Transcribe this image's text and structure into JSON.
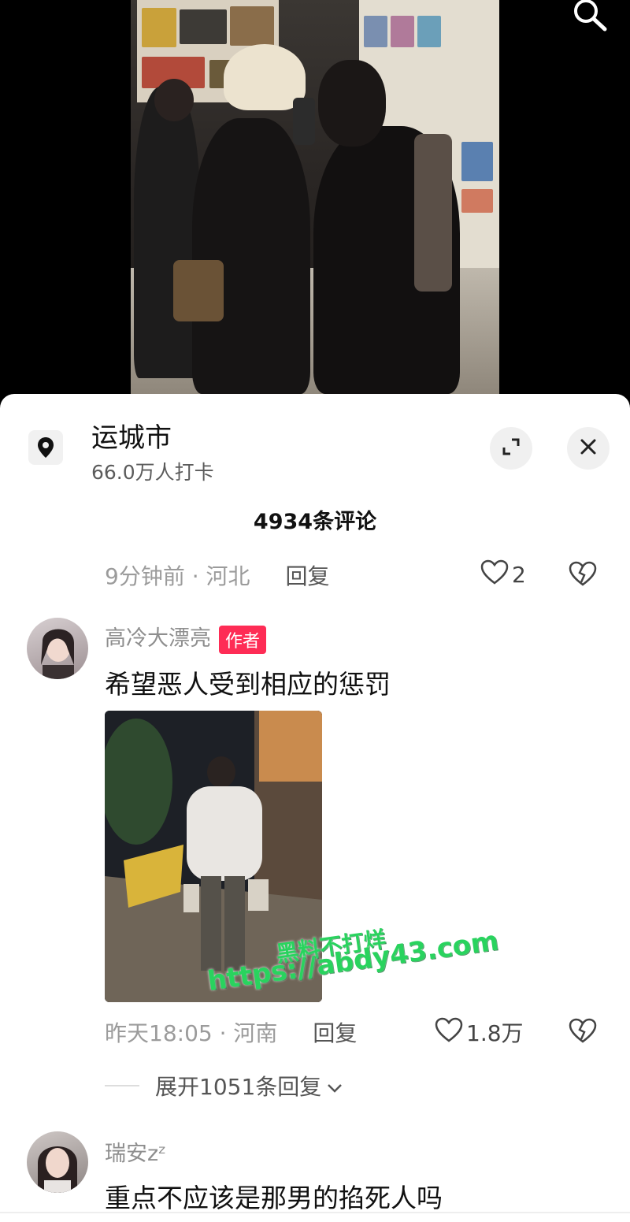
{
  "location": {
    "title": "运城市",
    "subtitle": "66.0万人打卡"
  },
  "comments_header": {
    "count_label": "4934条评论"
  },
  "previous_comment": {
    "time_location": "9分钟前 · 河北",
    "reply_label": "回复",
    "likes": "2"
  },
  "comment1": {
    "username": "高冷大漂亮",
    "badge": "作者",
    "text": "希望恶人受到相应的惩罚",
    "time_location": "昨天18:05 · 河南",
    "reply_label": "回复",
    "likes": "1.8万",
    "expand_label": "展开1051条回复"
  },
  "comment2": {
    "username": "瑞安zᶻ",
    "text": "重点不应该是那男的掐死人吗"
  },
  "watermark": {
    "line1": "黑料不打烊",
    "line2": "https://abdy43.com"
  },
  "colors": {
    "accent_badge": "#fe2c55",
    "watermark": "#29d35e"
  },
  "icons": {
    "search": "search-icon",
    "location": "location-pin-icon",
    "expand": "expand-icon",
    "close": "close-icon",
    "like": "heart-icon",
    "dislike": "broken-heart-icon",
    "chevron": "chevron-down-icon"
  }
}
